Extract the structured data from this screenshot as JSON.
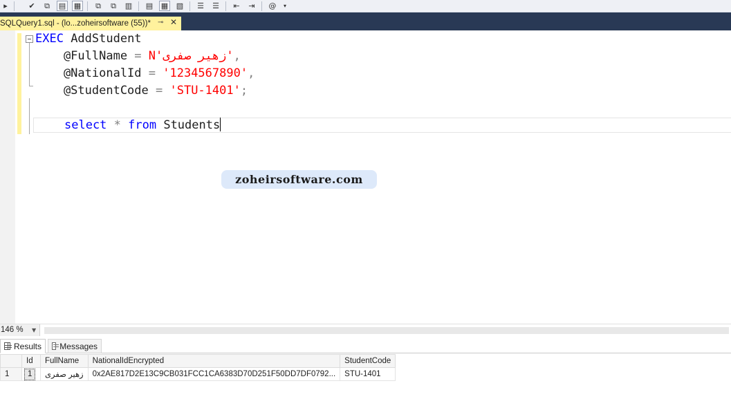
{
  "toolbar": {
    "icons": [
      "execute-icon",
      "checkmark-icon",
      "query-plan-icon",
      "display-plan-icon",
      "query-icon",
      "results-to-grid-icon",
      "comment-icon",
      "uncomment-icon",
      "indent-icon",
      "outdent-icon",
      "specify-values-icon"
    ]
  },
  "tab": {
    "title": "SQLQuery1.sql - (lo...zoheirsoftware (55))*",
    "pin_glyph": "⊸",
    "close_glyph": "✕"
  },
  "editor": {
    "line1": {
      "kw": "EXEC",
      "rest": " AddStudent"
    },
    "line2": {
      "param": "    @FullName",
      "op": " = ",
      "val": "N'زهیر صفری'",
      "punc": ","
    },
    "line3": {
      "param": "    @NationalId",
      "op": " = ",
      "val": "'1234567890'",
      "punc": ","
    },
    "line4": {
      "param": "    @StudentCode",
      "op": " = ",
      "val": "'STU-1401'",
      "punc": ";"
    },
    "line6": {
      "kw1": "select",
      "op": " * ",
      "kw2": "from",
      "rest": " Students"
    }
  },
  "watermark": "zoheirsoftware.com",
  "zoom": {
    "value": "146 %"
  },
  "result_tabs": {
    "results": "Results",
    "messages": "Messages"
  },
  "grid": {
    "columns": [
      "",
      "Id",
      "FullName",
      "NationalIdEncrypted",
      "StudentCode"
    ],
    "rows": [
      {
        "rownum": "1",
        "id": "1",
        "fullname": "زهیر صفری",
        "national": "0x2AE817D2E13C9CB031FCC1CA6383D70D251F50DD7DF0792...",
        "code": "STU-1401"
      }
    ]
  },
  "colors": {
    "tab_bg": "#293955",
    "active_tab": "#fff29d",
    "keyword": "#0000ff",
    "string": "#ff0000",
    "watermark_bg": "#dde9fa"
  }
}
